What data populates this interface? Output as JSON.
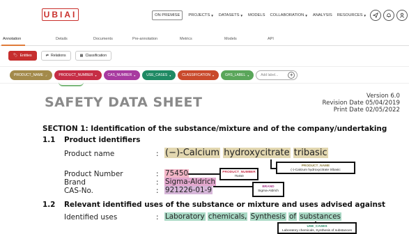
{
  "app": {
    "logo": "UBIAI",
    "nav": [
      {
        "label": "ON PREMISE",
        "caret": false
      },
      {
        "label": "PROJECTS",
        "caret": true
      },
      {
        "label": "DATASETS",
        "caret": true
      },
      {
        "label": "MODELS",
        "caret": false
      },
      {
        "label": "COLLABORATION",
        "caret": true
      },
      {
        "label": "ANALYSIS",
        "caret": false
      },
      {
        "label": "RESOURCES",
        "caret": true
      }
    ],
    "icons": [
      "send-icon",
      "bell-icon",
      "user-icon"
    ]
  },
  "tabs": [
    "Annotation",
    "Details",
    "Documents",
    "Pre-annotation",
    "Metrics",
    "Models",
    "API"
  ],
  "active_tab": "Annotation",
  "toolbar": {
    "entities": "Entities",
    "relations": "Relations",
    "classification": "Classification"
  },
  "labels": [
    {
      "name": "PRODUCT_NAME",
      "color": "#a38a4a",
      "checked": true
    },
    {
      "name": "PRODUCT_NUMBER",
      "color": "#c62d45",
      "checked": false
    },
    {
      "name": "CAS_NUMBER",
      "color": "#a83aa0",
      "checked": false
    },
    {
      "name": "USE_CASES",
      "color": "#1f8a64",
      "checked": false
    },
    {
      "name": "CLASSIFICATION",
      "color": "#c94a2c",
      "checked": false
    },
    {
      "name": "GHS_LABEL",
      "color": "#5aa65a",
      "checked": false
    }
  ],
  "add_label_placeholder": "Add label...",
  "document": {
    "title": "SAFETY DATA SHEET",
    "version": "Version 6.0",
    "revision_date": "Revision Date 05/04/2019",
    "print_date": "Print Date 02/05/2022",
    "section1": "SECTION 1: Identification of the substance/mixture and of the company/undertaking",
    "sub1_num": "1.1",
    "sub1_title": "Product identifiers",
    "sub2_num": "1.2",
    "sub2_title": "Relevant identified uses of the substance or mixture and uses advised against",
    "fields": {
      "product_name_label": "Product name",
      "product_name_parts": [
        "(−)-Calcium",
        "hydroxycitrate",
        "tribasic"
      ],
      "product_number_label": "Product Number",
      "product_number": "75450",
      "brand_label": "Brand",
      "brand": "Sigma-Aldrich",
      "cas_label": "CAS-No.",
      "cas": "921226-01-9",
      "uses_label": "Identified uses",
      "uses_parts": [
        "Laboratory",
        "chemicals,",
        "Synthesis",
        "of",
        "substances"
      ],
      "colon": ":"
    },
    "annotations": {
      "product_number": {
        "tag": "PRODUCT_NUMBER",
        "text": "75450"
      },
      "product_name": {
        "tag": "PRODUCT_NAME",
        "text": "(-)-Calcium hydroxycitrate tribasic"
      },
      "brand": {
        "tag": "BRAND",
        "text": "Sigma-Aldrich"
      },
      "use_cases": {
        "tag": "USE_CASES",
        "text": "Laboratory chemicals, Synthesis of substances"
      }
    }
  }
}
